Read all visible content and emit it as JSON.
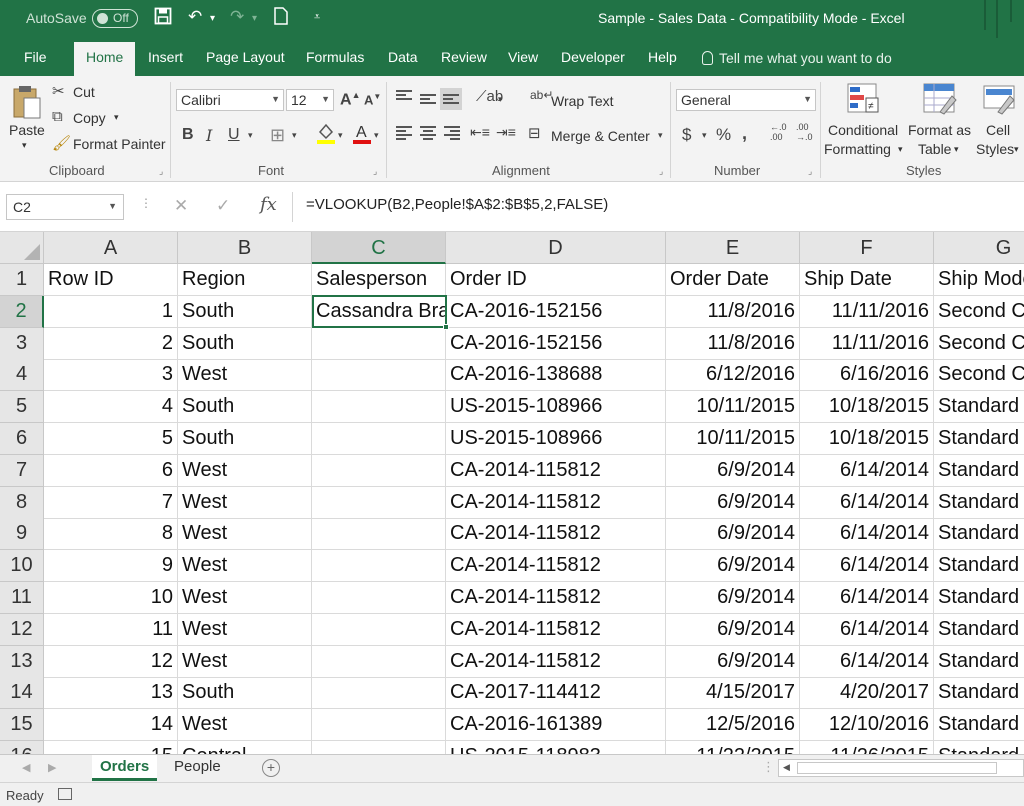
{
  "titlebar": {
    "autosave": "AutoSave",
    "toggle_state": "Off",
    "title": "Sample - Sales Data  -  Compatibility Mode  -  Excel"
  },
  "tabs": [
    {
      "label": "File"
    },
    {
      "label": "Home",
      "active": true
    },
    {
      "label": "Insert"
    },
    {
      "label": "Page Layout"
    },
    {
      "label": "Formulas"
    },
    {
      "label": "Data"
    },
    {
      "label": "Review"
    },
    {
      "label": "View"
    },
    {
      "label": "Developer"
    },
    {
      "label": "Help"
    }
  ],
  "tellme": "Tell me what you want to do",
  "ribbon": {
    "clipboard": {
      "paste": "Paste",
      "cut": "Cut",
      "copy": "Copy",
      "format_painter": "Format Painter",
      "group": "Clipboard"
    },
    "font": {
      "name": "Calibri",
      "size": "12",
      "group": "Font"
    },
    "alignment": {
      "wrap_text": "Wrap Text",
      "merge_center": "Merge & Center",
      "group": "Alignment"
    },
    "number": {
      "format": "General",
      "group": "Number"
    },
    "styles": {
      "conditional_1": "Conditional",
      "conditional_2": "Formatting",
      "format_table_1": "Format as",
      "format_table_2": "Table",
      "cell_styles_1": "Cell",
      "cell_styles_2": "Styles",
      "group": "Styles"
    }
  },
  "formula_bar": {
    "name_box": "C2",
    "formula": "=VLOOKUP(B2,People!$A$2:$B$5,2,FALSE)"
  },
  "grid": {
    "columns": [
      "A",
      "B",
      "C",
      "D",
      "E",
      "F",
      "G"
    ],
    "selected_column": "C",
    "selected_row": 2,
    "rows": [
      {
        "n": "1",
        "cells": [
          "Row ID",
          "Region",
          "Salesperson",
          "Order ID",
          "Order Date",
          "Ship Date",
          "Ship Mode"
        ]
      },
      {
        "n": "2",
        "cells": [
          "1",
          "South",
          "Cassandra Brandow",
          "CA-2016-152156",
          "11/8/2016",
          "11/11/2016",
          "Second Class"
        ]
      },
      {
        "n": "3",
        "cells": [
          "2",
          "South",
          "",
          "CA-2016-152156",
          "11/8/2016",
          "11/11/2016",
          "Second Class"
        ]
      },
      {
        "n": "4",
        "cells": [
          "3",
          "West",
          "",
          "CA-2016-138688",
          "6/12/2016",
          "6/16/2016",
          "Second Class"
        ]
      },
      {
        "n": "5",
        "cells": [
          "4",
          "South",
          "",
          "US-2015-108966",
          "10/11/2015",
          "10/18/2015",
          "Standard Class"
        ]
      },
      {
        "n": "6",
        "cells": [
          "5",
          "South",
          "",
          "US-2015-108966",
          "10/11/2015",
          "10/18/2015",
          "Standard Class"
        ]
      },
      {
        "n": "7",
        "cells": [
          "6",
          "West",
          "",
          "CA-2014-115812",
          "6/9/2014",
          "6/14/2014",
          "Standard Class"
        ]
      },
      {
        "n": "8",
        "cells": [
          "7",
          "West",
          "",
          "CA-2014-115812",
          "6/9/2014",
          "6/14/2014",
          "Standard Class"
        ]
      },
      {
        "n": "9",
        "cells": [
          "8",
          "West",
          "",
          "CA-2014-115812",
          "6/9/2014",
          "6/14/2014",
          "Standard Class"
        ]
      },
      {
        "n": "10",
        "cells": [
          "9",
          "West",
          "",
          "CA-2014-115812",
          "6/9/2014",
          "6/14/2014",
          "Standard Class"
        ]
      },
      {
        "n": "11",
        "cells": [
          "10",
          "West",
          "",
          "CA-2014-115812",
          "6/9/2014",
          "6/14/2014",
          "Standard Class"
        ]
      },
      {
        "n": "12",
        "cells": [
          "11",
          "West",
          "",
          "CA-2014-115812",
          "6/9/2014",
          "6/14/2014",
          "Standard Class"
        ]
      },
      {
        "n": "13",
        "cells": [
          "12",
          "West",
          "",
          "CA-2014-115812",
          "6/9/2014",
          "6/14/2014",
          "Standard Class"
        ]
      },
      {
        "n": "14",
        "cells": [
          "13",
          "South",
          "",
          "CA-2017-114412",
          "4/15/2017",
          "4/20/2017",
          "Standard Class"
        ]
      },
      {
        "n": "15",
        "cells": [
          "14",
          "West",
          "",
          "CA-2016-161389",
          "12/5/2016",
          "12/10/2016",
          "Standard Class"
        ]
      },
      {
        "n": "16",
        "cells": [
          "15",
          "Central",
          "",
          "US-2015-118983",
          "11/22/2015",
          "11/26/2015",
          "Standard Class"
        ]
      }
    ]
  },
  "sheets": [
    {
      "label": "Orders",
      "active": true
    },
    {
      "label": "People",
      "active": false
    }
  ],
  "status": {
    "ready": "Ready"
  },
  "colors": {
    "excel_green": "#217346",
    "ribbon_bg": "#f3f3f3",
    "header_bg": "#e6e6e6"
  }
}
